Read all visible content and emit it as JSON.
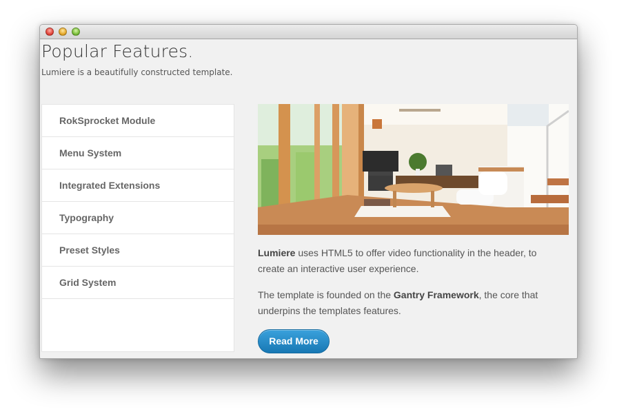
{
  "header": {
    "title": "Popular Features.",
    "subtitle": "Lumiere is a beautifully constructed template."
  },
  "menu": {
    "items": [
      {
        "label": "RokSprocket Module"
      },
      {
        "label": "Menu System"
      },
      {
        "label": "Integrated Extensions"
      },
      {
        "label": "Typography"
      },
      {
        "label": "Preset Styles"
      },
      {
        "label": "Grid System"
      }
    ]
  },
  "content": {
    "paragraph1": {
      "strong": "Lumiere",
      "text": " uses HTML5 to offer video functionality in the header, to create an interactive user experience."
    },
    "paragraph2": {
      "before": "The template is founded on the ",
      "strong": "Gantry Framework",
      "after": ", the core that underpins the templates features."
    },
    "read_more_label": "Read More"
  },
  "colors": {
    "accent": "#1f86c5",
    "window_bg": "#f1f1f1",
    "menu_text": "#666666"
  }
}
